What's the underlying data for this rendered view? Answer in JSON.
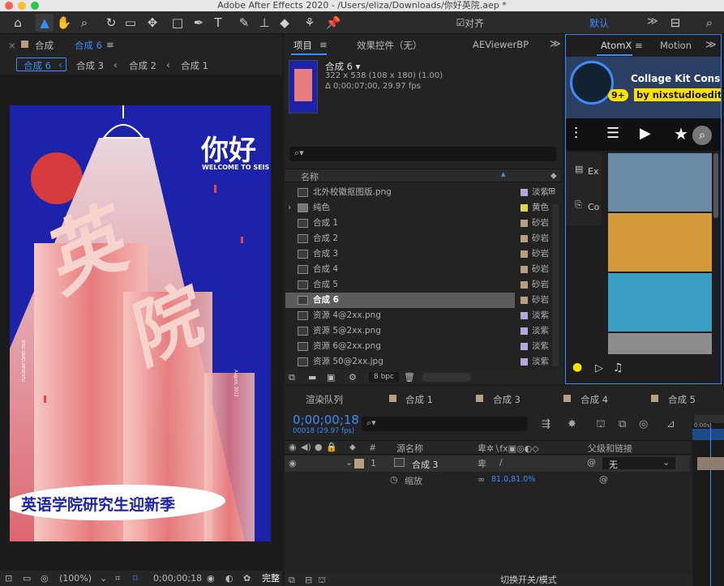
{
  "app": {
    "title": "Adobe After Effects 2020 - /Users/eliza/Downloads/你好英院.aep *"
  },
  "toolbar": {
    "snap_label": "对齐",
    "workspace_default": "默认",
    "workspace_menu": "≫"
  },
  "comp_viewer": {
    "tab_label": "合成",
    "tab_name": "合成 6",
    "breadcrumbs": [
      "合成 6",
      "合成 3",
      "合成 2",
      "合成 1"
    ],
    "zoom": "(100%)",
    "timecode": "0;00;00;18",
    "resolution": "完整"
  },
  "poster": {
    "headline": "你好",
    "welcome": "WELCOME TO SEIS",
    "banner": "英语学院研究生迎新季",
    "side_text": "SISU.GRAD.NEW.STU",
    "date_text": "August, 2022",
    "big_chars": [
      "英",
      "院"
    ]
  },
  "project": {
    "tabs": [
      "项目",
      "效果控件（无）",
      "AEViewerBP"
    ],
    "comp_name": "合成 6 ▾",
    "comp_size": "322 x 538  (108 x 180) (1.00)",
    "comp_duration": "Δ 0;00;07;00, 29.97 fps",
    "search_placeholder": "⌕▾",
    "col_name": "名称",
    "items": [
      {
        "name": "北外校徽抠图版.png",
        "color": "#b6a6d9",
        "type": "淡紫"
      },
      {
        "name": "纯色",
        "color": "#e2d44a",
        "type": "黄色"
      },
      {
        "name": "合成 1",
        "color": "#b89f82",
        "type": "砂岩"
      },
      {
        "name": "合成 2",
        "color": "#b89f82",
        "type": "砂岩"
      },
      {
        "name": "合成 3",
        "color": "#b89f82",
        "type": "砂岩"
      },
      {
        "name": "合成 4",
        "color": "#b89f82",
        "type": "砂岩"
      },
      {
        "name": "合成 5",
        "color": "#b89f82",
        "type": "砂岩"
      },
      {
        "name": "合成 6",
        "color": "#b89f82",
        "type": "砂岩"
      },
      {
        "name": "资源 4@2xx.png",
        "color": "#b6a6d9",
        "type": "淡紫"
      },
      {
        "name": "资源 5@2xx.png",
        "color": "#b6a6d9",
        "type": "淡紫"
      },
      {
        "name": "资源 6@2xx.png",
        "color": "#b6a6d9",
        "type": "淡紫"
      },
      {
        "name": "资源 50@2xx.jpg",
        "color": "#b6a6d9",
        "type": "淡紫"
      }
    ],
    "bpc": "8 bpc"
  },
  "atomx": {
    "tabs": [
      "AtomX",
      "Motion"
    ],
    "banner_title": "Collage Kit Cons",
    "banner_by": "by nixstudioediti",
    "badge": "9+",
    "side_labels": [
      "Ex",
      "Co"
    ]
  },
  "timeline": {
    "tabs": [
      "渲染队列",
      "合成 1",
      "合成 3",
      "合成 4",
      "合成 5"
    ],
    "timecode": "0;00;00;18",
    "frame_info": "00018 (29.97 fps)",
    "col_index": "#",
    "col_source": "源名称",
    "col_parent": "父级和链接",
    "layer_index": "1",
    "layer_name": "合成 3",
    "parent_value": "无",
    "prop_name": "缩放",
    "prop_value": "81.0,81.0%",
    "ruler": "0:00s",
    "bottom_label": "切换开关/模式"
  }
}
